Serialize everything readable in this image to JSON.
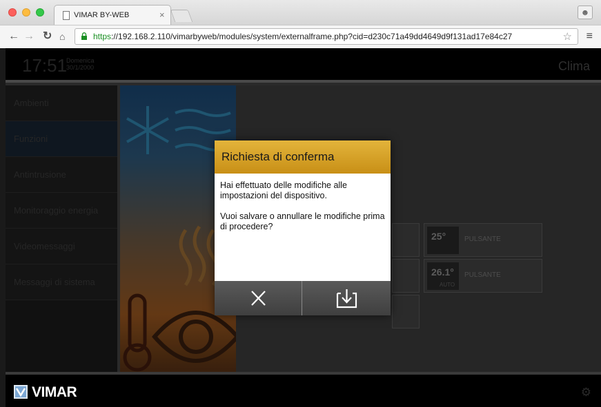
{
  "browser": {
    "tab_title": "VIMAR BY-WEB",
    "tab_close": "×",
    "url_scheme": "https",
    "url_rest": "://192.168.2.110/vimarbyweb/modules/system/externalframe.php?cid=d230c71a49dd4649d9f131ad17e84c27"
  },
  "header": {
    "time": "17:51",
    "day": "Domenica",
    "date": "30/1/2000",
    "section": "Clima"
  },
  "sidebar": {
    "items": [
      {
        "label": "Ambienti"
      },
      {
        "label": "Funzioni"
      },
      {
        "label": "Antintrusione"
      },
      {
        "label": "Monitoraggio energia"
      },
      {
        "label": "Videomessaggi"
      },
      {
        "label": "Messaggi di sistema"
      }
    ]
  },
  "controls": [
    {
      "temp": "25°",
      "sub": "",
      "label": "PULSANTE"
    },
    {
      "temp": "26.1°",
      "sub": "AUTO",
      "label": "PULSANTE"
    }
  ],
  "dialog": {
    "title": "Richiesta di conferma",
    "para1": "Hai effettuato delle modifiche alle impostazioni del dispositivo.",
    "para2": "Vuoi salvare o annullare le modifiche prima di procedere?"
  },
  "footer": {
    "brand": "VIMAR"
  },
  "colors": {
    "dialog_header": "#d9a52a",
    "accent_blue": "#7ba7d4"
  }
}
